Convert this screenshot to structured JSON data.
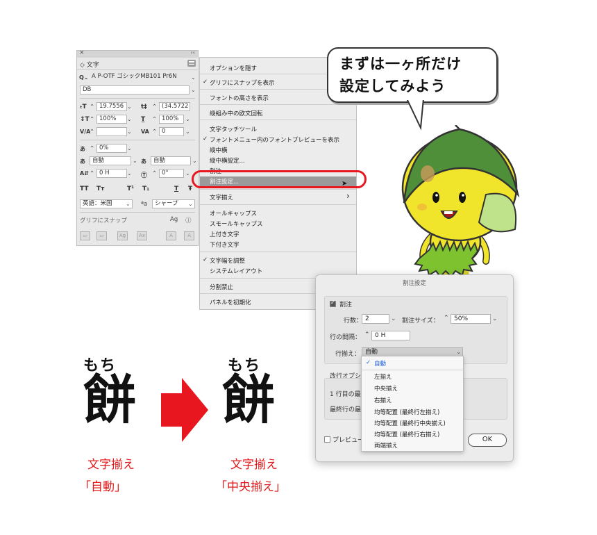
{
  "char_panel": {
    "title": "文字",
    "font_family": "A P-OTF ゴシックMB101 Pr6N",
    "font_style": "DB",
    "size": "19.7556",
    "leading": "(34.5722",
    "vscale": "100%",
    "hscale": "100%",
    "tracking": "0",
    "tsume": "0%",
    "aki_left": "自動",
    "aki_right": "自動",
    "baseline": "0 H",
    "rotation": "0°",
    "lang": "英語：米国",
    "aa": "シャープ",
    "snap_label": "グリフにスナップ",
    "caps_all": "TT",
    "caps_small": "Tт",
    "super": "T¹",
    "sub": "T₁",
    "underline": "T",
    "strike": "Ŧ"
  },
  "flyout": {
    "items": [
      {
        "label": "オプションを隠す",
        "check": ""
      },
      {
        "label": "グリフにスナップを表示",
        "check": "✓"
      },
      {
        "label": "フォントの高さを表示",
        "check": ""
      },
      {
        "label": "縦組み中の欧文回転",
        "check": ""
      },
      {
        "label": "文字タッチツール",
        "check": ""
      },
      {
        "label": "フォントメニュー内のフォントプレビューを表示",
        "check": "✓"
      },
      {
        "label": "縦中横",
        "check": ""
      },
      {
        "label": "縦中横設定...",
        "check": ""
      },
      {
        "label": "割注",
        "check": ""
      },
      {
        "label": "割注設定...",
        "check": ""
      },
      {
        "label": "文字揃え",
        "check": ""
      },
      {
        "label": "オールキャップス",
        "check": ""
      },
      {
        "label": "スモールキャップス",
        "check": ""
      },
      {
        "label": "上付き文字",
        "check": ""
      },
      {
        "label": "下付き文字",
        "check": ""
      },
      {
        "label": "文字幅を調整",
        "check": "✓"
      },
      {
        "label": "システムレイアウト",
        "check": ""
      },
      {
        "label": "分割禁止",
        "check": ""
      },
      {
        "label": "パネルを初期化",
        "check": ""
      }
    ],
    "submenu_arrow": "›"
  },
  "bubble": {
    "line1": "まずは一ヶ所だけ",
    "line2": "設定してみよう"
  },
  "dialog": {
    "title": "割注設定",
    "warichu_label": "割注",
    "lines_label": "行数：",
    "lines_value": "2",
    "size_label": "割注サイズ：",
    "size_value": "50%",
    "gap_label": "行の間隔：",
    "gap_value": "0 H",
    "align_label": "行揃え：",
    "align_value": "自動",
    "break_section": "改行オプシ",
    "first_line": "1 行目の最",
    "last_line": "最終行の最",
    "preview_label": "プレビュー",
    "ok_label": "OK"
  },
  "dropdown": {
    "items": [
      {
        "label": "自動",
        "selected": true
      },
      {
        "label": "左揃え",
        "selected": false
      },
      {
        "label": "中央揃え",
        "selected": false
      },
      {
        "label": "右揃え",
        "selected": false
      },
      {
        "label": "均等配置 (最終行左揃え)",
        "selected": false
      },
      {
        "label": "均等配置 (最終行中央揃え)",
        "selected": false
      },
      {
        "label": "均等配置 (最終行右揃え)",
        "selected": false
      },
      {
        "label": "両端揃え",
        "selected": false
      }
    ],
    "check_glyph": "✓"
  },
  "compare": {
    "left": {
      "ruby": "もち",
      "kanji": "餅",
      "cap1": "文字揃え",
      "cap2": "「自動」"
    },
    "right": {
      "ruby": "もち",
      "kanji": "餅",
      "cap1": "文字揃え",
      "cap2": "「中央揃え」"
    }
  },
  "colors": {
    "accent_red": "#e8161f",
    "mascot_green": "#4f8f3a",
    "mascot_yellow": "#f1e52c",
    "selection_blue": "#1a5fd6"
  }
}
